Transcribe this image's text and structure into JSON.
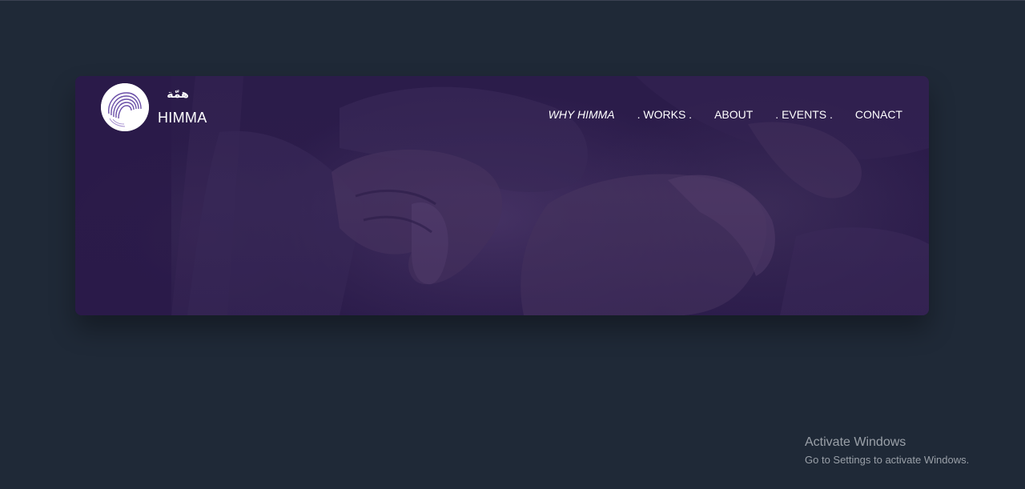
{
  "header": {
    "brand_arabic": "همّة",
    "brand_name": "HIMMA",
    "logo_icon": "spiral-logo-icon"
  },
  "nav": {
    "items": [
      {
        "label": "WHY HIMMA"
      },
      {
        "label": ". WORKS ."
      },
      {
        "label": "ABOUT"
      },
      {
        "label": ". EVENTS ."
      },
      {
        "label": "CONACT"
      }
    ]
  },
  "hero": {
    "background": "team-hands-photo-purple-overlay"
  },
  "watermark": {
    "title": "Activate Windows",
    "subtitle": "Go to Settings to activate Windows."
  },
  "colors": {
    "page_background": "#1f2937",
    "hero_tint": "#2e1f4e",
    "logo_accent": "#6b4fa8",
    "text": "#ffffff",
    "watermark_text": "#9aa0a8"
  }
}
